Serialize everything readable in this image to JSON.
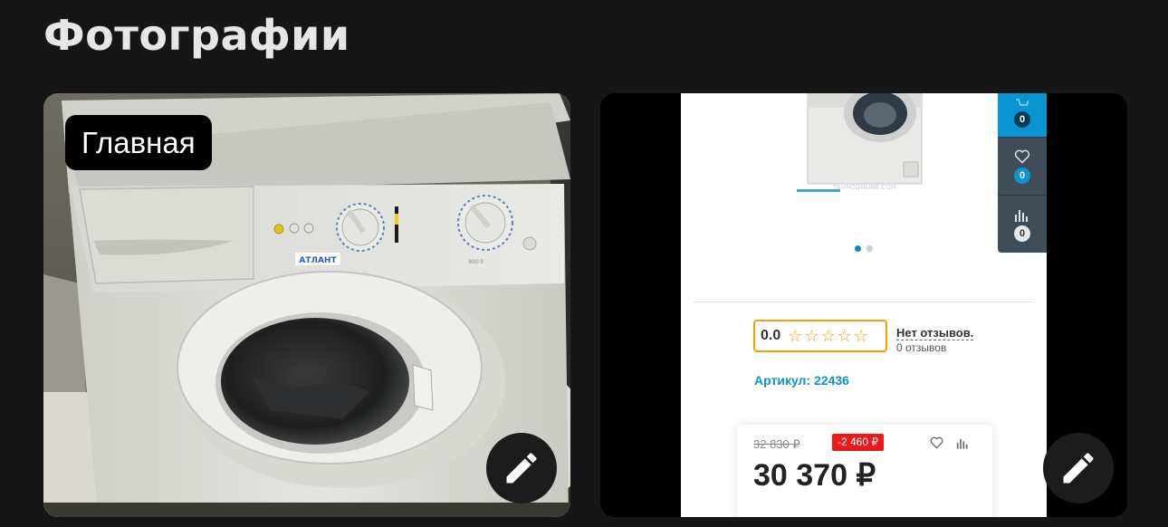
{
  "page": {
    "title": "Фотографии"
  },
  "photos": [
    {
      "badge": "Главная",
      "image": "washing-machine-photo",
      "appliance": {
        "brand": "АТЛАНТ",
        "model": "800 E"
      },
      "edit_icon": "pencil-icon"
    },
    {
      "image": "shop-page-screenshot",
      "shop": {
        "watermark": "TEHNOONLINE.COM",
        "side_counters": [
          {
            "icon": "cart-icon",
            "count": "0"
          },
          {
            "icon": "heart-icon",
            "count": "0"
          },
          {
            "icon": "chart-icon",
            "count": "0"
          }
        ],
        "rating": "0.0",
        "reviews_link": "Нет отзывов.",
        "reviews_count": "0 отзывов",
        "sku": "Артикул: 22436",
        "old_price": "32 830 ₽",
        "discount": "-2 460 ₽",
        "price": "30 370 ₽"
      },
      "edit_icon": "pencil-icon"
    }
  ],
  "colors": {
    "background": "#161616",
    "accent": "#0a94d0",
    "discount": "#e81a1a",
    "stars": "#f2a100"
  }
}
